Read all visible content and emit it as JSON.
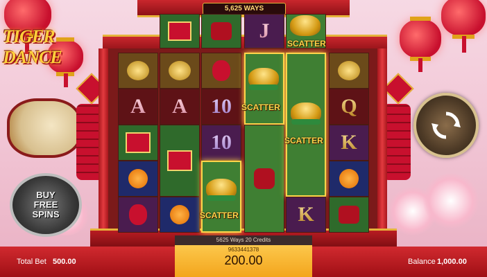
{
  "game": {
    "title": "TIGER DANCE",
    "ways_banner": "5,625 WAYS"
  },
  "reels": {
    "scatter_label": "SCATTER",
    "symbols": {
      "letter_A": "A",
      "letter_ten": "10",
      "letter_J": "J",
      "letter_Q": "Q",
      "letter_K": "K"
    }
  },
  "buy_free_spins": {
    "line1": "BUY",
    "line2": "FREE",
    "line3": "SPINS"
  },
  "info": {
    "ways_credits": "5625 Ways  20 Credits",
    "round_id": "9633441378"
  },
  "bottom": {
    "total_bet_label": "Total Bet",
    "total_bet_value": "500.00",
    "win_value": "200.00",
    "balance_label": "Balance",
    "balance_value": "1,000.00"
  },
  "colors": {
    "accent_gold": "#ffd54a",
    "bar_red": "#c8102e"
  }
}
